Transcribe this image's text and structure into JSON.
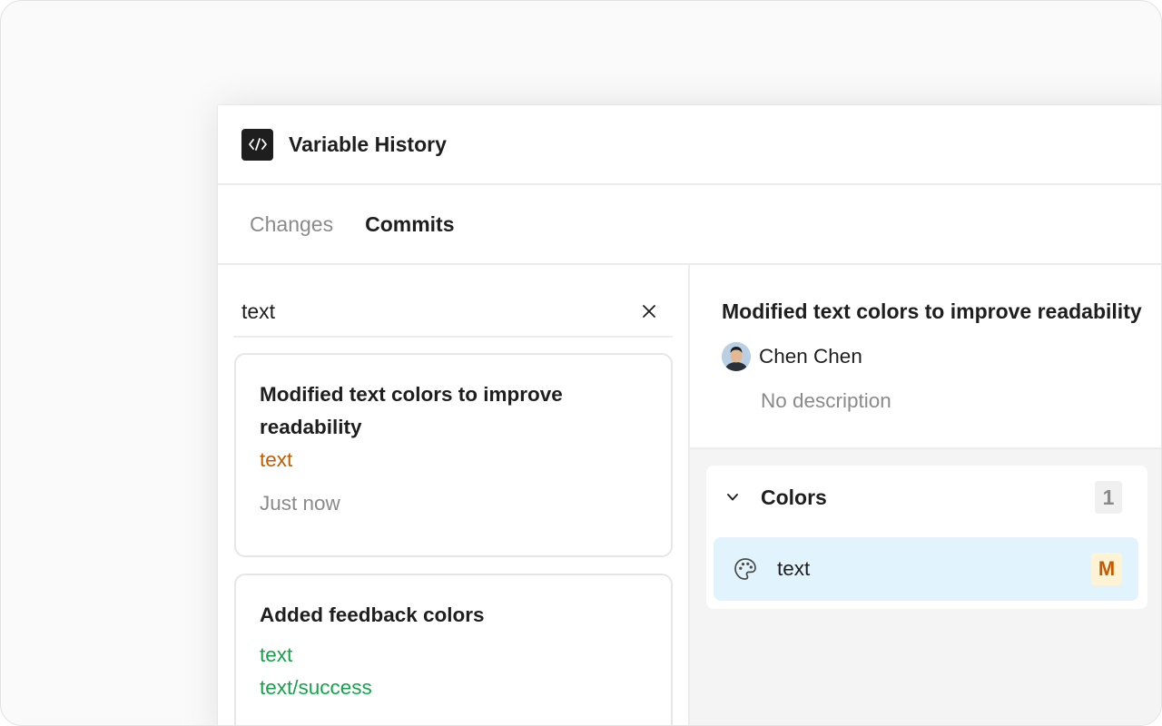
{
  "window": {
    "title": "Variable History",
    "app_icon": "code-icon"
  },
  "tabs": [
    {
      "label": "Changes",
      "active": false
    },
    {
      "label": "Commits",
      "active": true
    }
  ],
  "search": {
    "value": "text",
    "clear_icon": "close-icon"
  },
  "commits": [
    {
      "title_line1": "Modified text colors to improve",
      "title_line2": "readability",
      "variables": [
        "text"
      ],
      "change_type": "modified",
      "time": "Just now"
    },
    {
      "title_line1": "Added feedback colors",
      "variables": [
        "text",
        "text/success"
      ],
      "change_type": "added"
    }
  ],
  "detail": {
    "title": "Modified text colors to improve readability",
    "author": "Chen Chen",
    "description": "No description",
    "groups": [
      {
        "name": "Colors",
        "count": "1",
        "expanded": true,
        "items": [
          {
            "name": "text",
            "icon": "palette-icon",
            "status": "M"
          }
        ]
      }
    ]
  },
  "colors": {
    "modified": "#c35c00",
    "added": "#14a34b",
    "selected_row": "#e1f3fc",
    "status_badge_bg": "#fff3d6"
  }
}
